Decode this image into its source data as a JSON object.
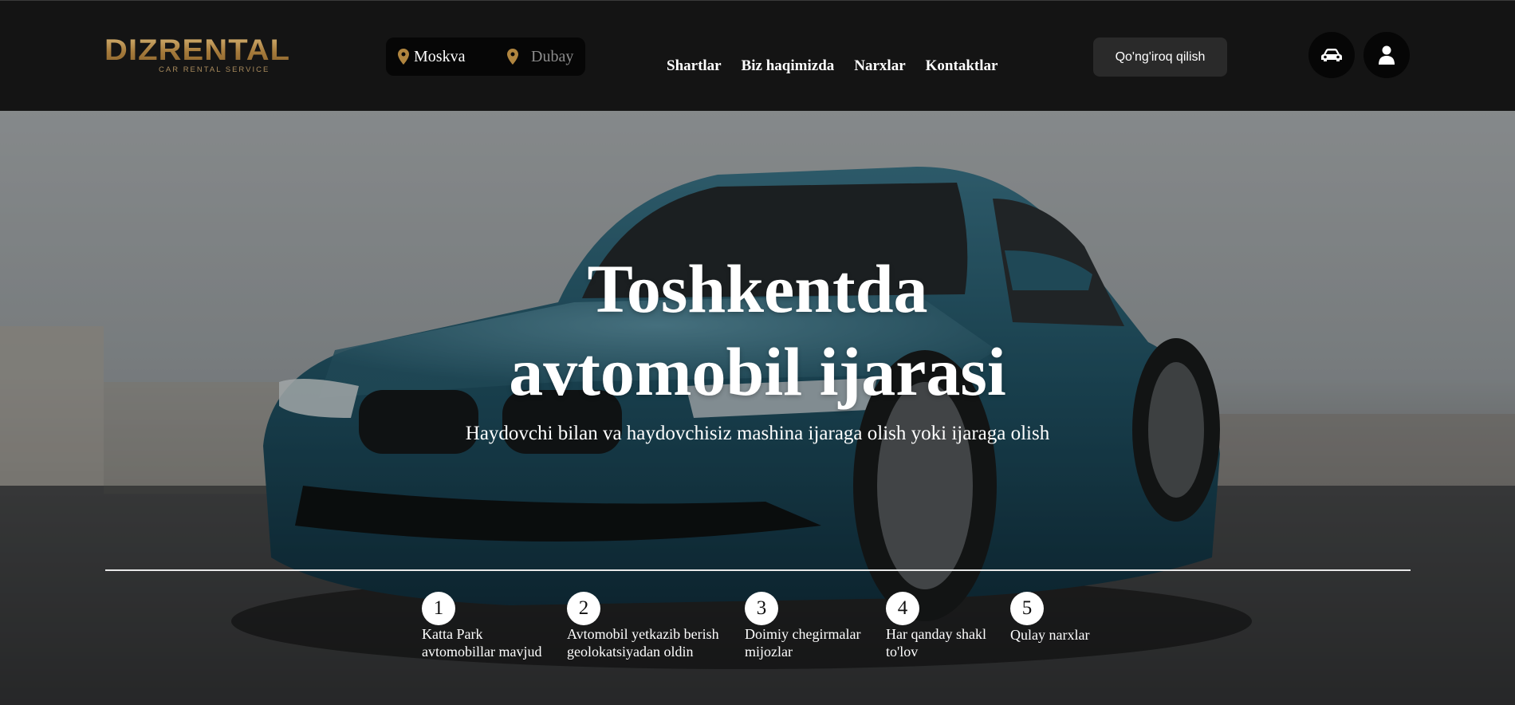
{
  "brand": {
    "logo_text": "DIZRENTAL",
    "logo_subtitle": "CAR RENTAL SERVICE",
    "gold": "#b48a4d"
  },
  "city_switch": {
    "cities": [
      {
        "label": "Moskva",
        "active": true
      },
      {
        "label": "Dubay",
        "active": false
      }
    ],
    "pin_icon": "map-pin-icon"
  },
  "nav": {
    "items": [
      "Shartlar",
      "Biz haqimizda",
      "Narxlar",
      "Kontaktlar"
    ]
  },
  "header_actions": {
    "call_label": "Qo'ng'iroq qilish",
    "car_icon": "car-icon",
    "user_icon": "user-icon"
  },
  "hero": {
    "title_line1": "Toshkentda",
    "title_line2": "avtomobil ijarasi",
    "subtitle": "Haydovchi bilan va haydovchisiz mashina ijaraga olish yoki ijaraga olish"
  },
  "features": [
    {
      "num": "1",
      "line1": "Katta Park",
      "line2": "avtomobillar mavjud"
    },
    {
      "num": "2",
      "line1": "Avtomobil yetkazib berish",
      "line2": "geolokatsiyadan oldin"
    },
    {
      "num": "3",
      "line1": "Doimiy chegirmalar",
      "line2": "mijozlar"
    },
    {
      "num": "4",
      "line1": "Har qanday shakl",
      "line2": "to'lov"
    },
    {
      "num": "5",
      "line1": "Qulay narxlar",
      "line2": ""
    }
  ]
}
